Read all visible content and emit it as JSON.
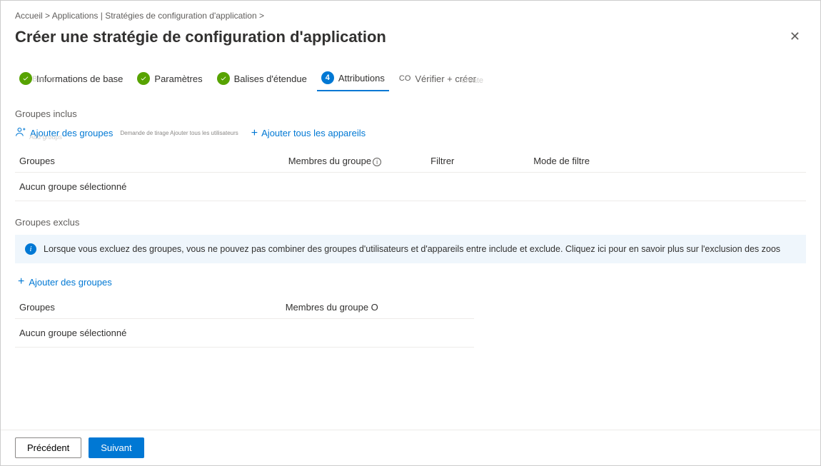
{
  "breadcrumb": {
    "home": "Accueil >",
    "path": "Applications | Stratégies de configuration d'application >"
  },
  "title": "Créer une stratégie de configuration d'application",
  "steps": {
    "s1_label": "Informations de base",
    "s1_faded": "Basics",
    "s2_label": "Paramètres",
    "s3_label": "Balises d'étendue",
    "s4_label": "Attributions",
    "s4_num": "4",
    "s5_prefix": "CO",
    "s5_label": "Vérifier + créer",
    "s5_faded": "create"
  },
  "included": {
    "section_label": "Groupes inclus",
    "add_groups": "Ajouter des groupes",
    "add_groups_faded": "Add groups",
    "tiny_label": "Demande de tirage Ajouter tous les utilisateurs",
    "add_all_devices": "Ajouter tous les appareils",
    "col_groups": "Groupes",
    "col_members": "Membres du groupe",
    "col_filter": "Filtrer",
    "col_filter_mode": "Mode de filtre",
    "empty": "Aucun groupe sélectionné"
  },
  "excluded": {
    "section_label": "Groupes exclus",
    "info_text": "Lorsque vous excluez des groupes, vous ne pouvez pas combiner des groupes d'utilisateurs et d'appareils entre include et exclude. Cliquez ici pour en savoir plus sur l'exclusion des zoos",
    "add_groups": "Ajouter des groupes",
    "col_groups": "Groupes",
    "col_members": "Membres du groupe O",
    "empty": "Aucun groupe sélectionné"
  },
  "footer": {
    "prev": "Précédent",
    "next": "Suivant"
  }
}
